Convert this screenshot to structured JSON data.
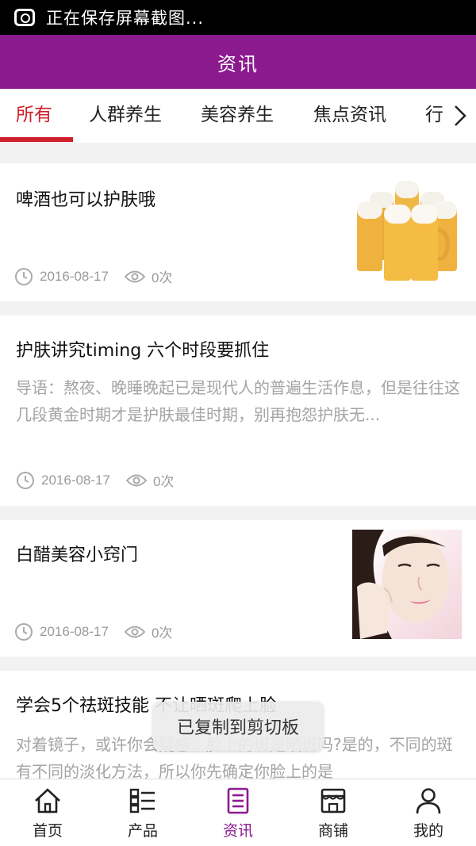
{
  "status_bar": {
    "text": "正在保存屏幕截图..."
  },
  "header": {
    "title": "资讯"
  },
  "tabs": [
    {
      "label": "所有",
      "active": true
    },
    {
      "label": "人群养生",
      "active": false
    },
    {
      "label": "美容养生",
      "active": false
    },
    {
      "label": "焦点资讯",
      "active": false
    },
    {
      "label": "行",
      "active": false
    }
  ],
  "articles": [
    {
      "title": "啤酒也可以护肤哦",
      "summary": "",
      "date": "2016-08-17",
      "views": "0次",
      "thumbnail": "beer-mugs-image"
    },
    {
      "title": "护肤讲究timing 六个时段要抓住",
      "summary": "导语：熬夜、晚睡晚起已是现代人的普遍生活作息，但是往往这几段黄金时期才是护肤最佳时期，别再抱怨护肤无...",
      "date": "2016-08-17",
      "views": "0次",
      "thumbnail": ""
    },
    {
      "title": "白醋美容小窍门",
      "summary": "",
      "date": "2016-08-17",
      "views": "0次",
      "thumbnail": "woman-face-image"
    },
    {
      "title": "学会5个祛斑技能 不让晒斑爬上脸",
      "summary": "对着镜子，或许你会疑惑：脸上的斑是晒斑吗?是的，不同的斑有不同的淡化方法，所以你先确定你脸上的是",
      "date": "",
      "views": "",
      "thumbnail": ""
    }
  ],
  "toast": {
    "text": "已复制到剪切板"
  },
  "bottom_nav": [
    {
      "label": "首页",
      "icon": "home-icon",
      "active": false
    },
    {
      "label": "产品",
      "icon": "list-icon",
      "active": false
    },
    {
      "label": "资讯",
      "icon": "news-icon",
      "active": true
    },
    {
      "label": "商铺",
      "icon": "shop-icon",
      "active": false
    },
    {
      "label": "我的",
      "icon": "user-icon",
      "active": false
    }
  ],
  "colors": {
    "brand": "#8b1a8f",
    "active_tab": "#d0202a",
    "meta_text": "#9a9a9a"
  }
}
